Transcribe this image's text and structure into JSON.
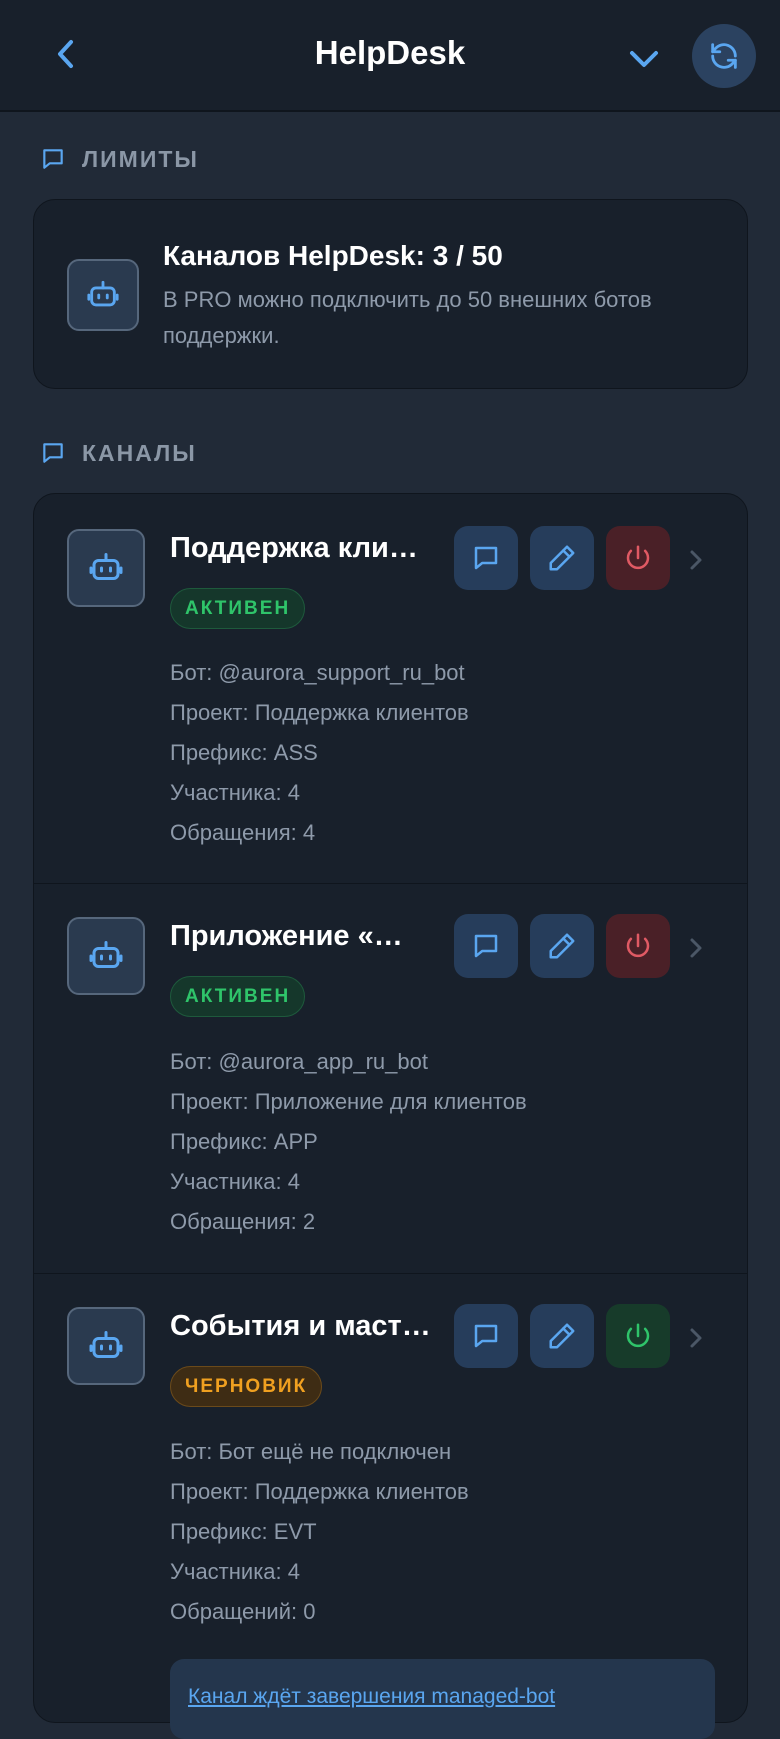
{
  "header": {
    "title": "HelpDesk",
    "icons": {
      "back": "chevron-left-icon",
      "collapse": "chevron-down-icon",
      "refresh": "refresh-icon"
    }
  },
  "limits_section": {
    "label": "ЛИМИТЫ",
    "title": "Каналов HelpDesk: 3 / 50",
    "description": "В PRO можно подключить до 50 внешних ботов поддержки."
  },
  "channels_section": {
    "label": "КАНАЛЫ",
    "channels": [
      {
        "name": "Поддержка кли…",
        "status": "АКТИВЕН",
        "bot": "Бот: @aurora_support_ru_bot",
        "project": "Проект: Поддержка клиентов",
        "prefix": "Префикс: ASS",
        "members": "Участника: 4",
        "requests": "Обращения: 4"
      },
      {
        "name": "Приложение «…",
        "status": "АКТИВЕН",
        "bot": "Бот: @aurora_app_ru_bot",
        "project": "Проект: Приложение для клиентов",
        "prefix": "Префикс: APP",
        "members": "Участника: 4",
        "requests": "Обращения: 2"
      },
      {
        "name": "События и маст…",
        "status": "ЧЕРНОВИК",
        "bot": "Бот: Бот ещё не подключен",
        "project": "Проект: Поддержка клиентов",
        "prefix": "Префикс: EVT",
        "members": "Участника: 4",
        "requests": "Обращений: 0",
        "notice": "Канал ждёт завершения managed-bot"
      }
    ]
  },
  "colors": {
    "background": "#212a37",
    "card": "#18202b",
    "accent": "#5aa6f0",
    "active": "#2fc46a",
    "draft": "#f0a020",
    "danger": "#e05a64"
  }
}
